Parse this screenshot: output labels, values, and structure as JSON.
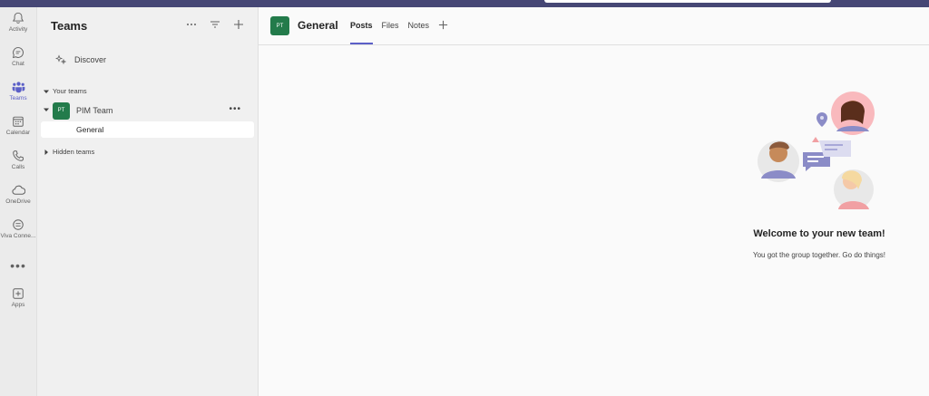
{
  "rail": {
    "items": [
      {
        "label": "Activity",
        "icon": "bell-icon"
      },
      {
        "label": "Chat",
        "icon": "chat-icon"
      },
      {
        "label": "Teams",
        "icon": "teams-icon"
      },
      {
        "label": "Calendar",
        "icon": "calendar-icon"
      },
      {
        "label": "Calls",
        "icon": "phone-icon"
      },
      {
        "label": "OneDrive",
        "icon": "cloud-icon"
      },
      {
        "label": "Viva Conne...",
        "icon": "viva-icon"
      },
      {
        "label": "Apps",
        "icon": "apps-icon"
      }
    ],
    "more_label": "•••"
  },
  "panel": {
    "title": "Teams",
    "discover_label": "Discover",
    "your_teams_label": "Your teams",
    "hidden_teams_label": "Hidden teams",
    "team": {
      "initials": "PT",
      "name": "PIM Team",
      "avatar_color": "#237b4b"
    },
    "channel": "General"
  },
  "main": {
    "avatar_initials": "PT",
    "channel_title": "General",
    "tabs": [
      {
        "label": "Posts"
      },
      {
        "label": "Files"
      },
      {
        "label": "Notes"
      }
    ],
    "welcome_title": "Welcome to your new team!",
    "welcome_subtitle": "You got the group together. Go do things!"
  },
  "colors": {
    "accent": "#5b5fc7",
    "titlebar": "#464775",
    "team_avatar": "#237b4b"
  }
}
